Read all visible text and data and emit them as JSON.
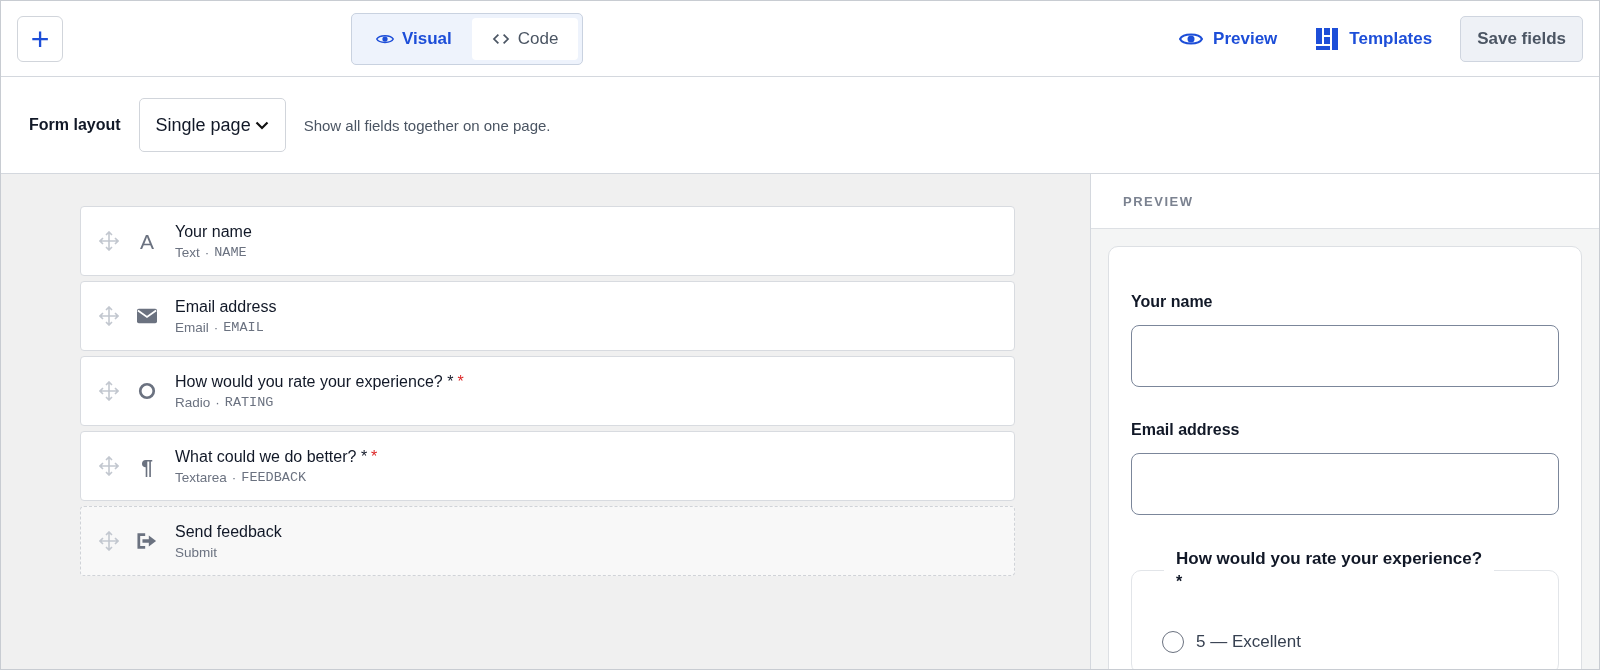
{
  "toolbar": {
    "add_button": "+",
    "tabs": [
      {
        "label": "Visual",
        "selected": true,
        "kind": "visual"
      },
      {
        "label": "Code",
        "selected": false,
        "kind": "code"
      }
    ],
    "actions": [
      {
        "label": "Preview",
        "kind": "preview"
      },
      {
        "label": "Templates",
        "kind": "templates"
      }
    ],
    "save_button": "Save fields"
  },
  "layout_bar": {
    "label": "Form layout",
    "select": "Single page",
    "hint": "Show all fields together on one page."
  },
  "fields": [
    {
      "kind": "text",
      "glyph": "A",
      "title": "Your name",
      "required": false,
      "type": "Text",
      "sep": "·",
      "key": "NAME"
    },
    {
      "kind": "email",
      "title": "Email address",
      "required": false,
      "type": "Email",
      "sep": "·",
      "key": "EMAIL"
    },
    {
      "kind": "radio",
      "title": "How would you rate your experience? *",
      "required": true,
      "type": "Radio",
      "sep": "·",
      "key": "RATING"
    },
    {
      "kind": "textarea",
      "glyph": "¶",
      "title": "What could we do better? *",
      "required": true,
      "type": "Textarea",
      "sep": "·",
      "key": "FEEDBACK"
    },
    {
      "kind": "submit",
      "title": "Send feedback",
      "required": false,
      "type": "Submit"
    }
  ],
  "preview": {
    "heading": "PREVIEW",
    "inputs": [
      {
        "label": "Your name"
      },
      {
        "label": "Email address"
      }
    ],
    "radio_group": {
      "legend": "How would you rate your experience?",
      "mark": "*",
      "options": [
        {
          "label": "5 — Excellent",
          "selected": false
        }
      ]
    }
  }
}
